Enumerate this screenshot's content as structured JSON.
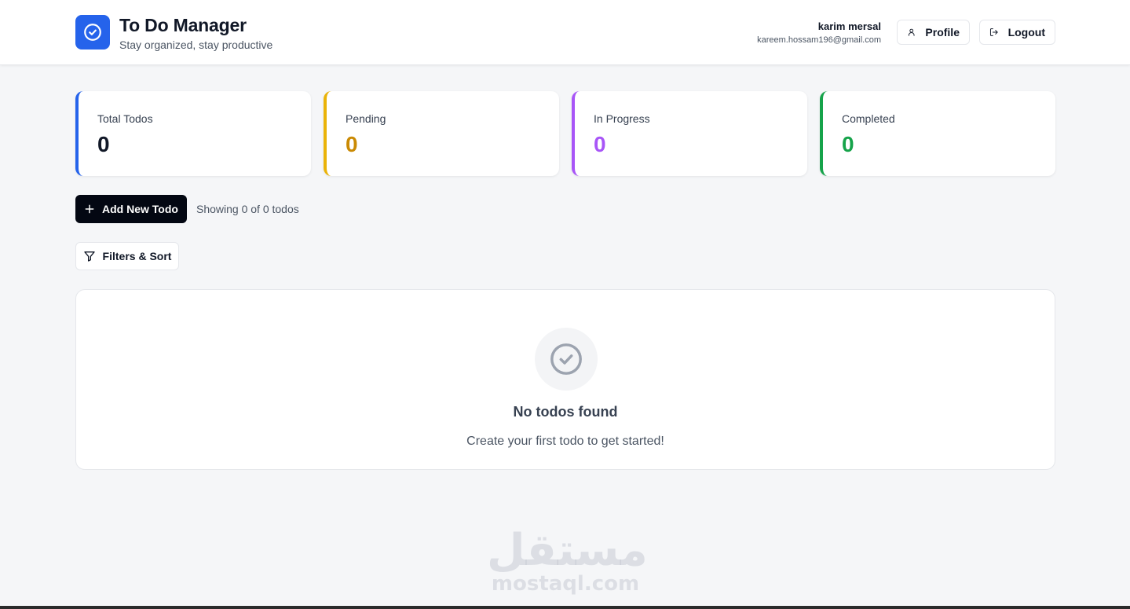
{
  "header": {
    "title": "To Do Manager",
    "subtitle": "Stay organized, stay productive",
    "logo_icon": "check-circle-icon",
    "user": {
      "name": "karim mersal",
      "email": "kareem.hossam196@gmail.com"
    },
    "profile_button": "Profile",
    "logout_button": "Logout"
  },
  "stats": [
    {
      "label": "Total Todos",
      "value": "0",
      "color": "#2563eb",
      "value_color": "#111827"
    },
    {
      "label": "Pending",
      "value": "0",
      "color": "#eab308",
      "value_color": "#ca8a04"
    },
    {
      "label": "In Progress",
      "value": "0",
      "color": "#a855f7",
      "value_color": "#a855f7"
    },
    {
      "label": "Completed",
      "value": "0",
      "color": "#16a34a",
      "value_color": "#16a34a"
    }
  ],
  "actions": {
    "add_button": "Add New Todo",
    "showing_text": "Showing 0 of 0 todos",
    "filter_button": "Filters & Sort"
  },
  "empty_state": {
    "icon": "check-circle-icon",
    "title": "No todos found",
    "description": "Create your first todo to get started!"
  },
  "watermark": {
    "arabic": "مستقل",
    "latin": "mostaql.com"
  },
  "colors": {
    "accent": "#2563eb",
    "background": "#f5f6f8",
    "primary_button": "#030712"
  }
}
